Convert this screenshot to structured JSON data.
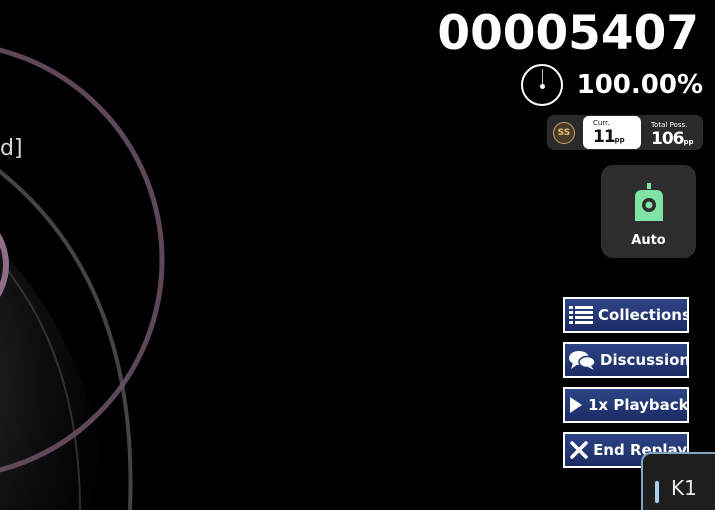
{
  "playfield": {
    "partial_text": "d]"
  },
  "hud": {
    "score": "00005407",
    "accuracy": "100.00%",
    "pp_counter": {
      "grade": "SS",
      "current_label": "Curr.",
      "current_value": "11",
      "total_label": "Total Poss.",
      "total_value": "106",
      "unit": "pp"
    },
    "mod": {
      "label": "Auto",
      "color": "#7fe3a4",
      "icon": "auto-bot-icon"
    }
  },
  "menu": {
    "buttons": [
      {
        "label": "Collections",
        "icon": "list-icon"
      },
      {
        "label": "Discussion",
        "icon": "chat-bubbles-icon"
      },
      {
        "label": "1x Playback",
        "icon": "play-icon"
      },
      {
        "label": "End Replay",
        "icon": "close-icon"
      }
    ]
  },
  "key_overlay": {
    "label": "K1",
    "accent": "#a9cfee"
  }
}
